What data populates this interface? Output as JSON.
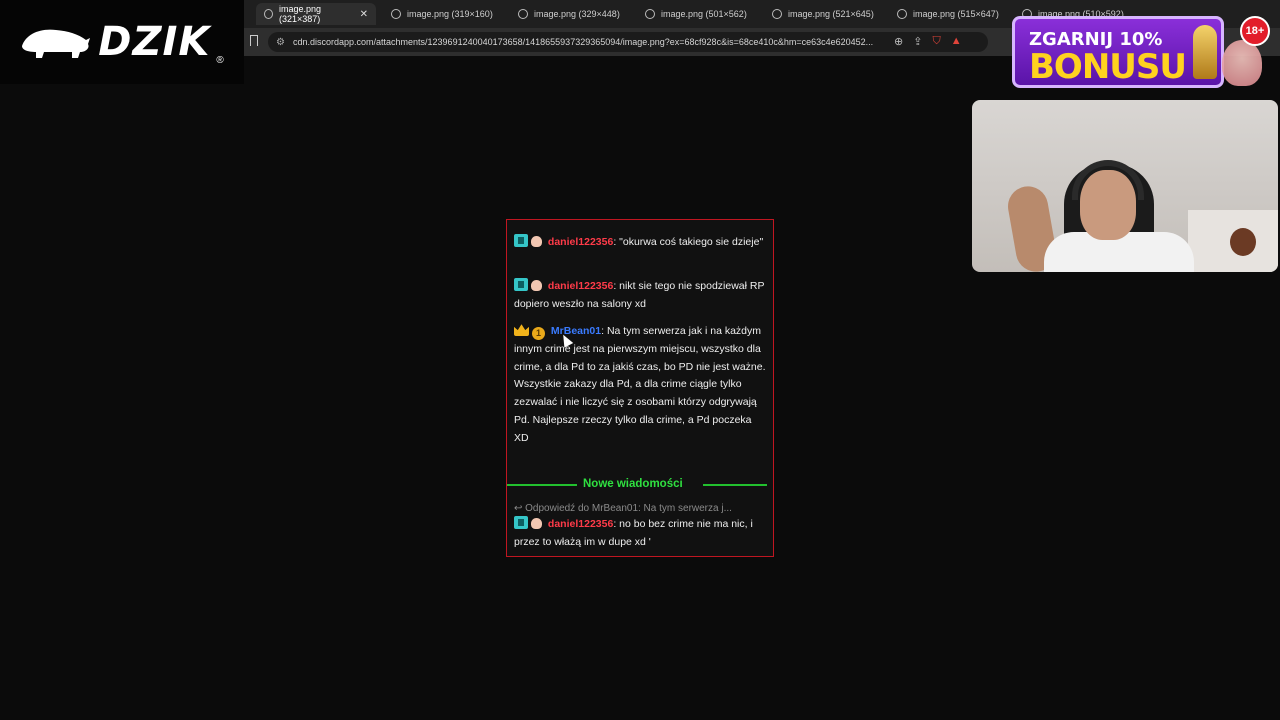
{
  "logo": {
    "text": "DZIK",
    "reg": "®"
  },
  "browser": {
    "tabs": [
      {
        "label": "image.png (321×387)",
        "active": true,
        "close": "✕"
      },
      {
        "label": "image.png (319×160)"
      },
      {
        "label": "image.png (329×448)"
      },
      {
        "label": "image.png (501×562)"
      },
      {
        "label": "image.png (521×645)"
      },
      {
        "label": "image.png (515×647)"
      },
      {
        "label": "image.png (510×592)"
      }
    ],
    "url": "cdn.discordapp.com/attachments/1239691240040173658/1418655937329365094/image.png?ex=68cf928c&is=68ce410c&hm=ce63c4e620452..."
  },
  "ad": {
    "line1": "ZGARNIJ 10%",
    "line2": "BONUSU",
    "age": "18+"
  },
  "chat": {
    "messages": [
      {
        "user": "daniel122356",
        "text": ": \"okurwa coś takiego sie dzieje\""
      },
      {
        "user": "daniel122356",
        "text": ": nikt sie tego nie spodziewał RP dopiero weszło na salony xd"
      },
      {
        "user": "MrBean01",
        "badge": "1",
        "text": ": Na tym serwerza jak i na każdym innym crime jest na pierwszym miejscu, wszystko dla crime, a dla Pd to za jakiś czas, bo PD nie jest ważne. Wszystkie zakazy dla Pd, a dla crime ciągle tylko zezwalać i nie liczyć się z osobami którzy odgrywają Pd. Najlepsze rzeczy tylko dla crime, a Pd poczeka XD"
      },
      {
        "user": "daniel122356",
        "text": ": no bo bez crime nie ma nic, i przez to włażą im w dupe xd '"
      }
    ],
    "divider_label": "Nowe wiadomości",
    "reply_preview": "↩ Odpowiedź do MrBean01: Na tym serwerza j..."
  },
  "colors": {
    "accent_red": "#c01621",
    "username_red": "#ff3b49",
    "username_blue": "#3a7bff",
    "divider_green": "#22c02e"
  }
}
